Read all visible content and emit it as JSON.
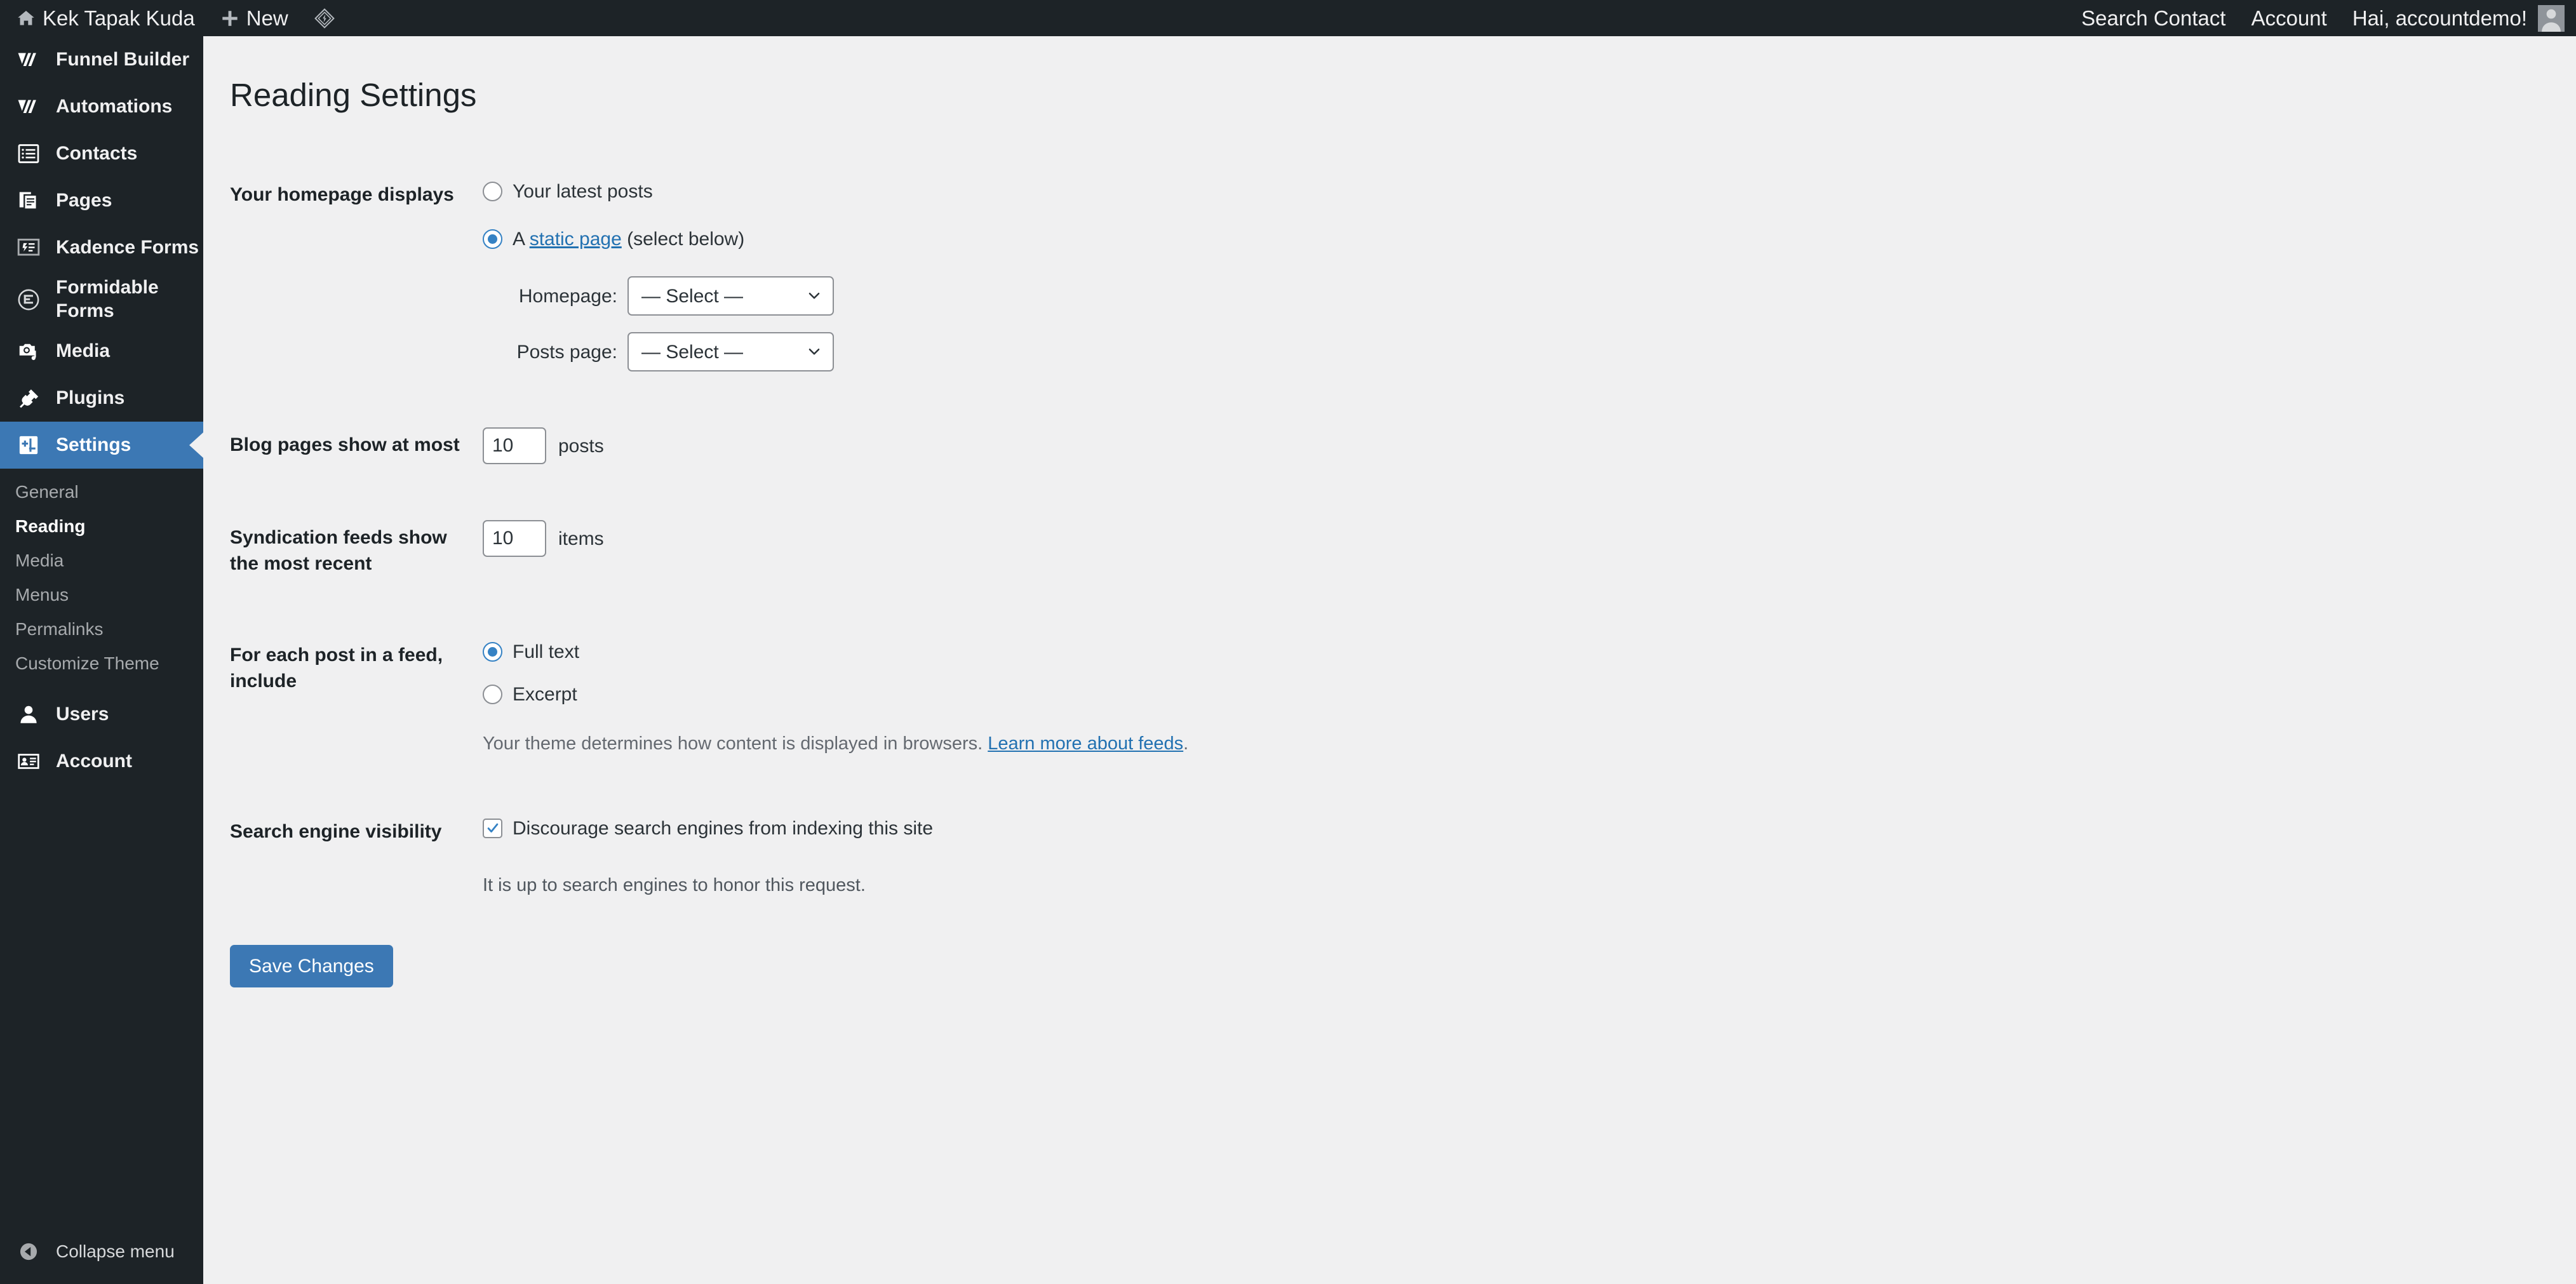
{
  "adminbar": {
    "left_items": [
      {
        "icon": "home-icon",
        "label": "Kek Tapak Kuda",
        "name": "site-name"
      },
      {
        "icon": "plus-icon",
        "label": "New",
        "name": "new-content"
      },
      {
        "icon": "diamond-logo-icon",
        "label": "",
        "name": "plugin-logo"
      }
    ],
    "right_items": [
      {
        "label": "Search Contact",
        "name": "search-contact"
      },
      {
        "label": "Account",
        "name": "account"
      },
      {
        "label": "Hai, accountdemo!",
        "name": "howdy"
      }
    ],
    "avatar_name": "avatar"
  },
  "sidebar": {
    "items": [
      {
        "label": "Funnel Builder",
        "icon": "funnel-builder-icon",
        "name": "sidebar-item-funnel-builder",
        "current": false
      },
      {
        "label": "Automations",
        "icon": "automations-icon",
        "name": "sidebar-item-automations",
        "current": false
      },
      {
        "label": "Contacts",
        "icon": "contacts-icon",
        "name": "sidebar-item-contacts",
        "current": false
      },
      {
        "label": "Pages",
        "icon": "pages-icon",
        "name": "sidebar-item-pages",
        "current": false
      },
      {
        "label": "Kadence Forms",
        "icon": "kadence-forms-icon",
        "name": "sidebar-item-kadence-forms",
        "current": false
      },
      {
        "label": "Formidable Forms",
        "icon": "formidable-forms-icon",
        "name": "sidebar-item-formidable-forms",
        "current": false
      },
      {
        "label": "Media",
        "icon": "media-icon",
        "name": "sidebar-item-media",
        "current": false
      },
      {
        "label": "Plugins",
        "icon": "plugins-icon",
        "name": "sidebar-item-plugins",
        "current": false
      },
      {
        "label": "Settings",
        "icon": "settings-icon",
        "name": "sidebar-item-settings",
        "current": true
      }
    ],
    "settings_submenu": [
      {
        "label": "General",
        "name": "submenu-general",
        "current": false
      },
      {
        "label": "Reading",
        "name": "submenu-reading",
        "current": true
      },
      {
        "label": "Media",
        "name": "submenu-media",
        "current": false
      },
      {
        "label": "Menus",
        "name": "submenu-menus",
        "current": false
      },
      {
        "label": "Permalinks",
        "name": "submenu-permalinks",
        "current": false
      },
      {
        "label": "Customize Theme",
        "name": "submenu-customize-theme",
        "current": false
      }
    ],
    "items_after": [
      {
        "label": "Users",
        "icon": "users-icon",
        "name": "sidebar-item-users"
      },
      {
        "label": "Account",
        "icon": "account-icon",
        "name": "sidebar-item-account"
      }
    ],
    "collapse_label": "Collapse menu"
  },
  "page": {
    "title": "Reading Settings"
  },
  "homepage_displays": {
    "label": "Your homepage displays",
    "option_latest": "Your latest posts",
    "option_static_prefix": "A ",
    "option_static_link": "static page",
    "option_static_suffix": " (select below)",
    "selected": "static",
    "homepage_label": "Homepage:",
    "homepage_value": "— Select —",
    "posts_page_label": "Posts page:",
    "posts_page_value": "— Select —"
  },
  "blog_pages": {
    "label": "Blog pages show at most",
    "value": "10",
    "unit": "posts"
  },
  "syndication": {
    "label": "Syndication feeds show the most recent",
    "value": "10",
    "unit": "items"
  },
  "feed_include": {
    "label": "For each post in a feed, include",
    "option_full": "Full text",
    "option_excerpt": "Excerpt",
    "selected": "full",
    "helper_prefix": "Your theme determines how content is displayed in browsers. ",
    "helper_link": "Learn more about feeds",
    "helper_suffix": "."
  },
  "search_visibility": {
    "label": "Search engine visibility",
    "checkbox_label": "Discourage search engines from indexing this site",
    "checked": true,
    "note": "It is up to search engines to honor this request."
  },
  "submit": {
    "save_label": "Save Changes"
  },
  "colors": {
    "accent": "#3c78b4",
    "link": "#2271b1",
    "sidebar_bg": "#1d2327",
    "page_bg": "#f0f0f1"
  }
}
